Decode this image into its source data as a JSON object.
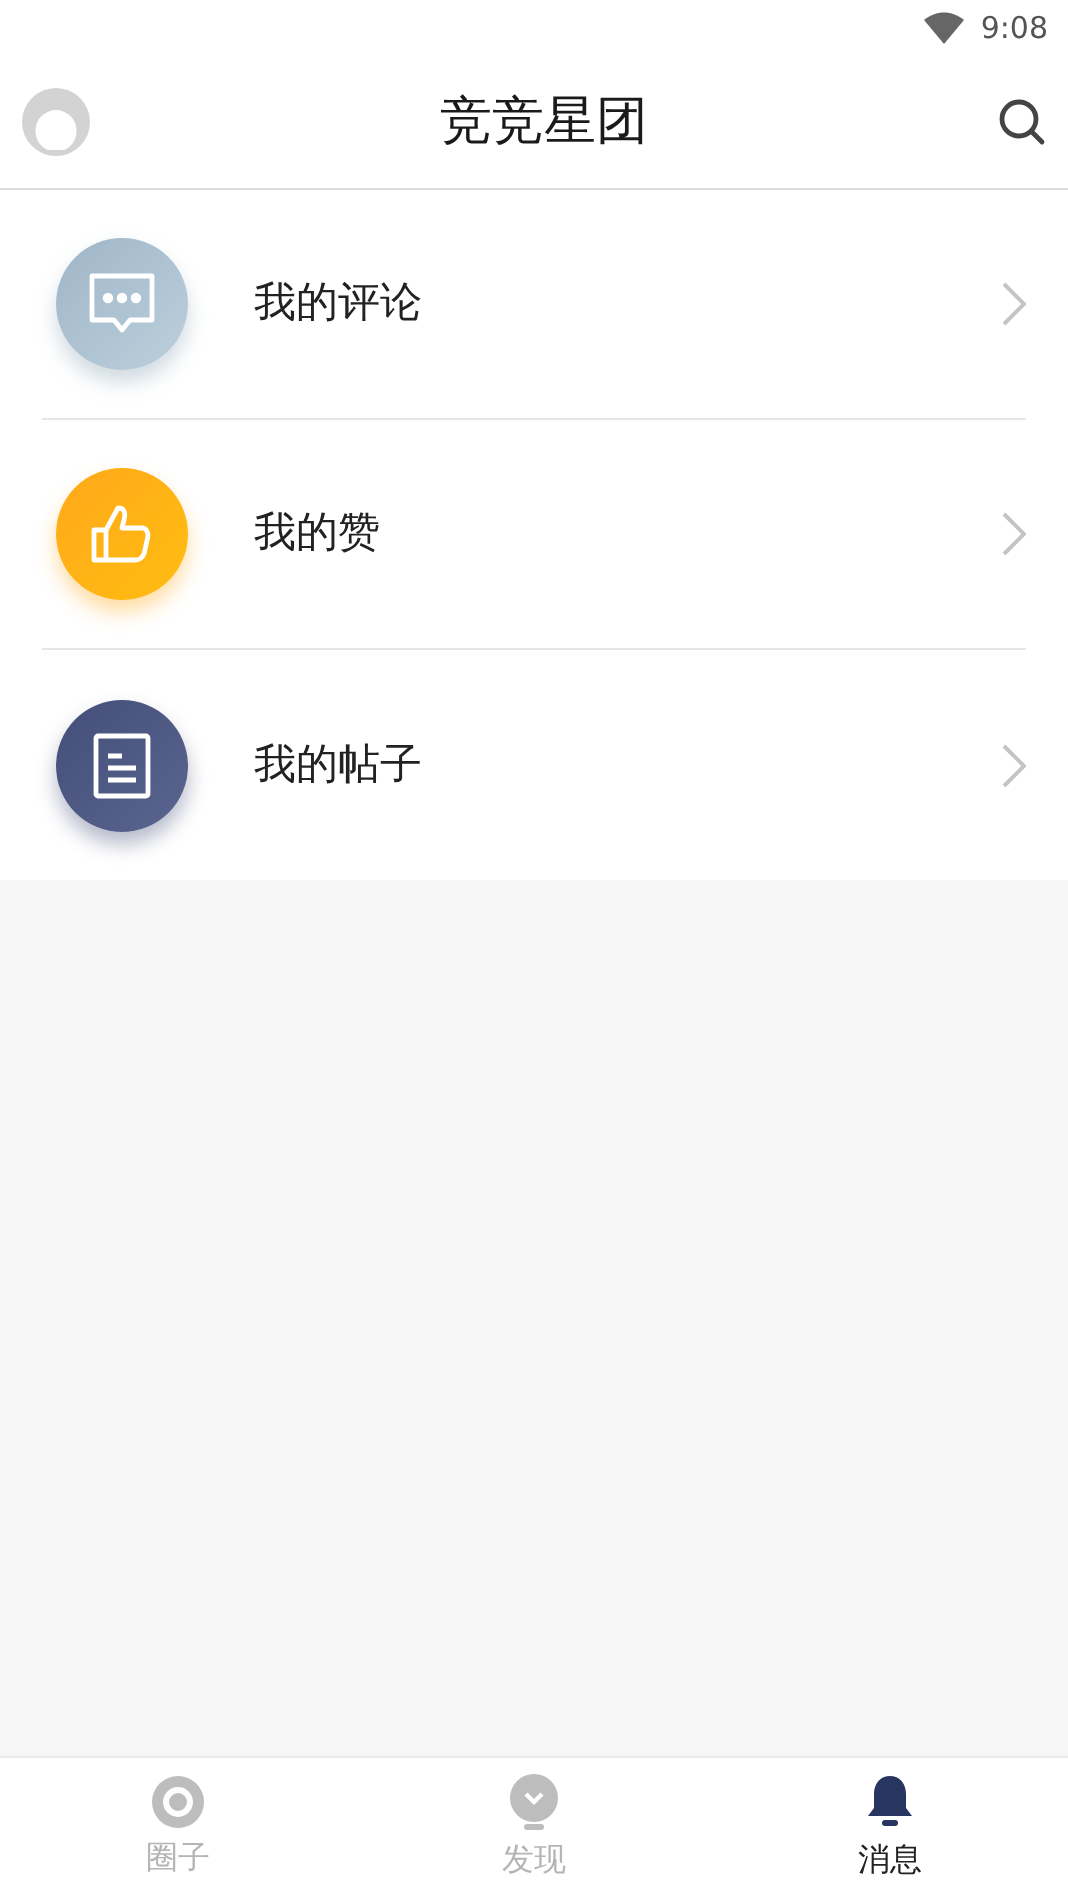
{
  "status_bar": {
    "time": "9:08"
  },
  "header": {
    "title": "竞竞星团"
  },
  "menu": [
    {
      "kind": "comment",
      "label": "我的评论"
    },
    {
      "kind": "like",
      "label": "我的赞"
    },
    {
      "kind": "post",
      "label": "我的帖子"
    }
  ],
  "tabs": [
    {
      "kind": "circle",
      "label": "圈子",
      "selected": false
    },
    {
      "kind": "discover",
      "label": "发现",
      "selected": false
    },
    {
      "kind": "bell",
      "label": "消息",
      "selected": true
    }
  ]
}
